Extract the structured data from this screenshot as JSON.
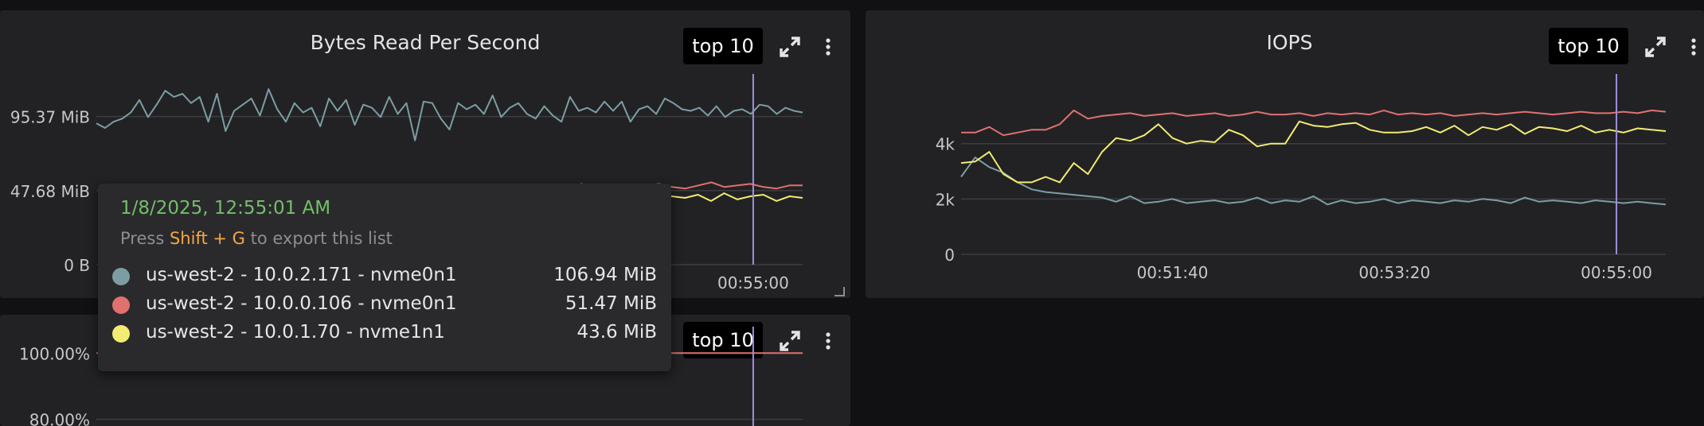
{
  "colors": {
    "green": "#7c9ea3",
    "red": "#e0716f",
    "yellow": "#f3ec72",
    "accent": "#f5a742",
    "time": "#73bf69",
    "cursor": "#a08edb"
  },
  "panels": [
    {
      "title": "Bytes Read Per Second",
      "top_label": "top 10",
      "expand_icon": "expand-icon",
      "menu_icon": "kebab-menu-icon"
    },
    {
      "title": "IOPS",
      "top_label": "top 10",
      "expand_icon": "expand-icon",
      "menu_icon": "kebab-menu-icon"
    },
    {
      "title": "",
      "top_label": "top 10",
      "expand_icon": "expand-icon",
      "menu_icon": "kebab-menu-icon"
    }
  ],
  "tooltip": {
    "time": "1/8/2025, 12:55:01 AM",
    "hint_press": "Press",
    "hint_key": "Shift + G",
    "hint_rest": "to export this list",
    "rows": [
      {
        "label": "us-west-2 - 10.0.2.171 - nvme0n1",
        "value": "106.94 MiB",
        "color": "#7c9ea3"
      },
      {
        "label": "us-west-2 - 10.0.0.106 - nvme0n1",
        "value": "51.47 MiB",
        "color": "#e0716f"
      },
      {
        "label": "us-west-2 - 10.0.1.70 - nvme1n1",
        "value": "43.6 MiB",
        "color": "#f3ec72"
      }
    ]
  },
  "chart_data": [
    {
      "type": "line",
      "title": "Bytes Read Per Second",
      "ylim": [
        0,
        110
      ],
      "yticks": [
        {
          "v": 0,
          "label": "0 B"
        },
        {
          "v": 47.68,
          "label": "47.68 MiB"
        },
        {
          "v": 95.37,
          "label": "95.37 MiB"
        }
      ],
      "xlim": [
        0,
        1
      ],
      "xticks": [
        {
          "v": 0.93,
          "label": "00:55:00"
        }
      ],
      "cursor_x": 0.93,
      "series": [
        {
          "name": "us-west-2 - 10.0.2.171 - nvme0n1",
          "color": "#7c9ea3",
          "start": 0,
          "values": [
            91,
            88,
            92,
            94,
            98,
            106,
            95,
            103,
            112,
            108,
            110,
            104,
            108,
            92,
            110,
            86,
            99,
            103,
            107,
            96,
            113,
            100,
            92,
            104,
            98,
            101,
            89,
            107,
            99,
            106,
            90,
            103,
            101,
            95,
            108,
            97,
            104,
            80,
            105,
            104,
            94,
            87,
            104,
            100,
            103,
            97,
            109,
            95,
            101,
            104,
            97,
            94,
            102,
            96,
            92,
            108,
            99,
            101,
            98,
            105,
            99,
            105,
            92,
            100,
            102,
            97,
            107,
            104,
            100,
            99,
            101,
            96,
            102,
            95,
            99,
            100,
            97,
            103,
            102,
            97,
            101,
            99,
            98
          ]
        },
        {
          "name": "us-west-2 - 10.0.0.106 - nvme0n1",
          "color": "#e0716f",
          "start": 0.17,
          "values": [
            46,
            49,
            47,
            50,
            47,
            48,
            47,
            49,
            48,
            47,
            50,
            48,
            47,
            49,
            48,
            48,
            47,
            48,
            49,
            48,
            47,
            49,
            50,
            51,
            48,
            51,
            49,
            48,
            52,
            50,
            49,
            48,
            50,
            51,
            52,
            50,
            49,
            51,
            53,
            50,
            51,
            52,
            50,
            49,
            51,
            51
          ]
        },
        {
          "name": "us-west-2 - 10.0.1.70 - nvme1n1",
          "color": "#f3ec72",
          "start": 0.5,
          "values": [
            43,
            44,
            42,
            45,
            43,
            44,
            43,
            46,
            42,
            44,
            43,
            45,
            44,
            42,
            46,
            43,
            45,
            44,
            43,
            45,
            41,
            46,
            42,
            44,
            45,
            41,
            44,
            43
          ]
        }
      ]
    },
    {
      "type": "line",
      "title": "IOPS",
      "ylim": [
        0,
        5800
      ],
      "yticks": [
        {
          "v": 0,
          "label": "0"
        },
        {
          "v": 2000,
          "label": "2k"
        },
        {
          "v": 4000,
          "label": "4k"
        }
      ],
      "xlim": [
        0,
        1
      ],
      "xticks": [
        {
          "v": 0.3,
          "label": "00:51:40"
        },
        {
          "v": 0.615,
          "label": "00:53:20"
        },
        {
          "v": 0.93,
          "label": "00:55:00"
        }
      ],
      "cursor_x": 0.93,
      "series": [
        {
          "name": "",
          "color": "#7c9ea3",
          "start": 0,
          "values": [
            2800,
            3500,
            3150,
            2950,
            2600,
            2350,
            2250,
            2200,
            2150,
            2100,
            2050,
            1900,
            2100,
            1850,
            1900,
            2000,
            1850,
            1900,
            1950,
            1850,
            1900,
            2050,
            1850,
            1950,
            1900,
            2100,
            1800,
            1950,
            1850,
            1900,
            2000,
            1850,
            1950,
            1900,
            1850,
            1950,
            1900,
            2000,
            1950,
            1850,
            2050,
            1900,
            1950,
            1900,
            1850,
            1950,
            1900,
            1850,
            1900,
            1850,
            1800
          ]
        },
        {
          "name": "",
          "color": "#e0716f",
          "start": 0,
          "values": [
            4400,
            4400,
            4600,
            4300,
            4400,
            4500,
            4500,
            4700,
            5200,
            4900,
            5000,
            5050,
            5100,
            5000,
            5050,
            5100,
            5000,
            5050,
            5100,
            5000,
            5050,
            5150,
            5050,
            5050,
            5100,
            5000,
            5100,
            5050,
            5100,
            5050,
            5200,
            5050,
            5100,
            5050,
            5100,
            5000,
            5050,
            5100,
            5050,
            5100,
            5150,
            5100,
            5050,
            5100,
            5150,
            5100,
            5100,
            5150,
            5100,
            5200,
            5150
          ]
        },
        {
          "name": "",
          "color": "#f3ec72",
          "start": 0,
          "values": [
            3300,
            3350,
            3700,
            2900,
            2600,
            2600,
            2800,
            2600,
            3300,
            2900,
            3700,
            4200,
            4100,
            4300,
            4700,
            4200,
            4000,
            4100,
            4050,
            4500,
            4300,
            3900,
            4000,
            4000,
            4800,
            4650,
            4600,
            4700,
            4750,
            4500,
            4400,
            4400,
            4450,
            4600,
            4400,
            4650,
            4300,
            4600,
            4500,
            4700,
            4350,
            4600,
            4550,
            4450,
            4650,
            4400,
            4500,
            4400,
            4550,
            4500,
            4450
          ]
        }
      ]
    },
    {
      "type": "line",
      "title": "",
      "ylim": [
        78,
        102
      ],
      "yticks": [
        {
          "v": 80,
          "label": "80.00%"
        },
        {
          "v": 100,
          "label": "100.00%"
        }
      ],
      "xlim": [
        0,
        1
      ],
      "xticks": [],
      "cursor_x": 0.93,
      "series": [
        {
          "name": "",
          "color": "#e0716f",
          "start": 0,
          "values": [
            100,
            100,
            100,
            100,
            100,
            100,
            100,
            100,
            100,
            100
          ]
        }
      ]
    }
  ]
}
